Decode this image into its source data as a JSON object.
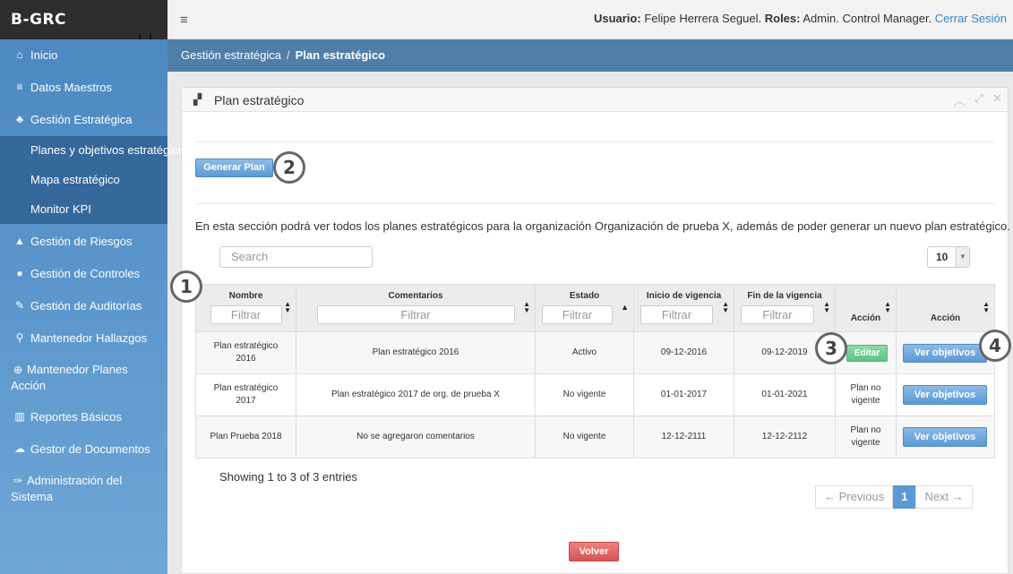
{
  "app": {
    "brand": "B-GRC"
  },
  "topbar": {
    "user_label": "Usuario:",
    "user_name": "Felipe Herrera Seguel.",
    "roles_label": "Roles:",
    "roles_value": "Admin. Control Manager.",
    "logout": "Cerrar Sesión"
  },
  "sidebar": {
    "items": [
      {
        "label": "Inicio",
        "icon": "home-icon",
        "glyph": "⌂"
      },
      {
        "label": "Datos Maestros",
        "icon": "list-icon",
        "glyph": "≡"
      },
      {
        "label": "Gestión Estratégica",
        "icon": "sitemap-icon",
        "glyph": "♣"
      },
      {
        "label": "Gestión de Riesgos",
        "icon": "warning-icon",
        "glyph": "▲"
      },
      {
        "label": "Gestión de Controles",
        "icon": "check-circle-icon",
        "glyph": "●"
      },
      {
        "label": "Gestión de Auditorías",
        "icon": "edit-icon",
        "glyph": "✎"
      },
      {
        "label": "Mantenedor Hallazgos",
        "icon": "search-icon",
        "glyph": "⚲"
      },
      {
        "label": "Mantenedor Planes Acción",
        "icon": "plus-circle-icon",
        "glyph": "⊕"
      },
      {
        "label": "Reportes Básicos",
        "icon": "bar-chart-icon",
        "glyph": "▥"
      },
      {
        "label": "Gestor de Documentos",
        "icon": "cloud-icon",
        "glyph": "☁"
      },
      {
        "label": "Administración del Sistema",
        "icon": "wrench-icon",
        "glyph": "✑"
      }
    ],
    "submenu": [
      {
        "label": "Planes y objetivos estratégicos"
      },
      {
        "label": "Mapa estratégico"
      },
      {
        "label": "Monitor KPI"
      }
    ]
  },
  "breadcrumb": {
    "parent": "Gestión estratégica",
    "separator": "/",
    "current": "Plan estratégico"
  },
  "panel": {
    "title": "Plan estratégico",
    "generate_button": "Generar Plan",
    "intro": "En esta sección podrá ver todos los planes estratégicos para la organización Organización de prueba X, además de poder generar un nuevo plan estratégico.",
    "search_placeholder": "Search",
    "page_size": "10",
    "filter_placeholder": "Filtrar",
    "columns": [
      "Nombre",
      "Comentarios",
      "Estado",
      "Inicio de vigencia",
      "Fin de la vigencia",
      "Acción",
      "Acción"
    ],
    "rows": [
      {
        "nombre": "Plan estratégico 2016",
        "comentarios": "Plan estratégico 2016",
        "estado": "Activo",
        "inicio": "09-12-2016",
        "fin": "09-12-2019",
        "accion1": "Editar",
        "accion2": "Ver objetivos"
      },
      {
        "nombre": "Plan estratégico 2017",
        "comentarios": "Plan estratégico 2017 de org. de prueba X",
        "estado": "No vigente",
        "inicio": "01-01-2017",
        "fin": "01-01-2021",
        "accion1": "Plan no vigente",
        "accion2": "Ver objetivos"
      },
      {
        "nombre": "Plan Prueba 2018",
        "comentarios": "No se agregaron comentarios",
        "estado": "No vigente",
        "inicio": "12-12-2111",
        "fin": "12-12-2112",
        "accion1": "Plan no vigente",
        "accion2": "Ver objetivos"
      }
    ],
    "showing": "Showing 1 to 3 of 3 entries",
    "pager": {
      "prev": "← Previous",
      "page": "1",
      "next": "Next →"
    },
    "back_button": "Volver"
  },
  "callouts": [
    "1",
    "2",
    "3",
    "4"
  ]
}
